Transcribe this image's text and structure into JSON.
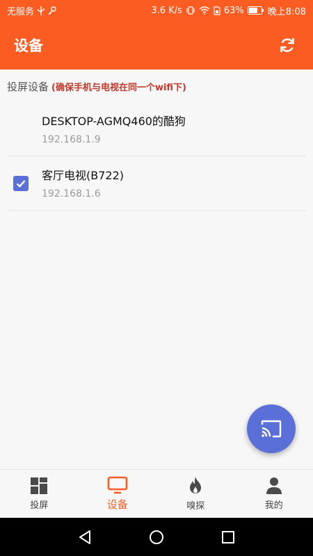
{
  "status_bar": {
    "carrier": "无服务",
    "network_speed": "3.6 K/s",
    "battery": "63%",
    "time": "晚上8:08"
  },
  "app_bar": {
    "title": "设备",
    "refresh_icon": "refresh-icon"
  },
  "section": {
    "label": "投屏设备",
    "note": "(确保手机与电视在同一个wifi下)"
  },
  "devices": [
    {
      "name": "DESKTOP-AGMQ460的酷狗",
      "ip": "192.168.1.9",
      "checked": false
    },
    {
      "name": "客厅电视(B722)",
      "ip": "192.168.1.6",
      "checked": true
    }
  ],
  "fab": {
    "icon": "cast-icon"
  },
  "bottom_nav": {
    "items": [
      {
        "label": "投屏",
        "icon": "grid-icon",
        "active": false
      },
      {
        "label": "设备",
        "icon": "tv-icon",
        "active": true
      },
      {
        "label": "嗅探",
        "icon": "flame-icon",
        "active": false
      },
      {
        "label": "我的",
        "icon": "person-icon",
        "active": false
      }
    ]
  },
  "system_nav": {
    "back_icon": "back-icon",
    "home_icon": "home-icon",
    "recents_icon": "recents-icon"
  },
  "colors": {
    "accent": "#fb5c22",
    "primary_blue": "#5b6fd8",
    "note_red": "#c0392b"
  }
}
